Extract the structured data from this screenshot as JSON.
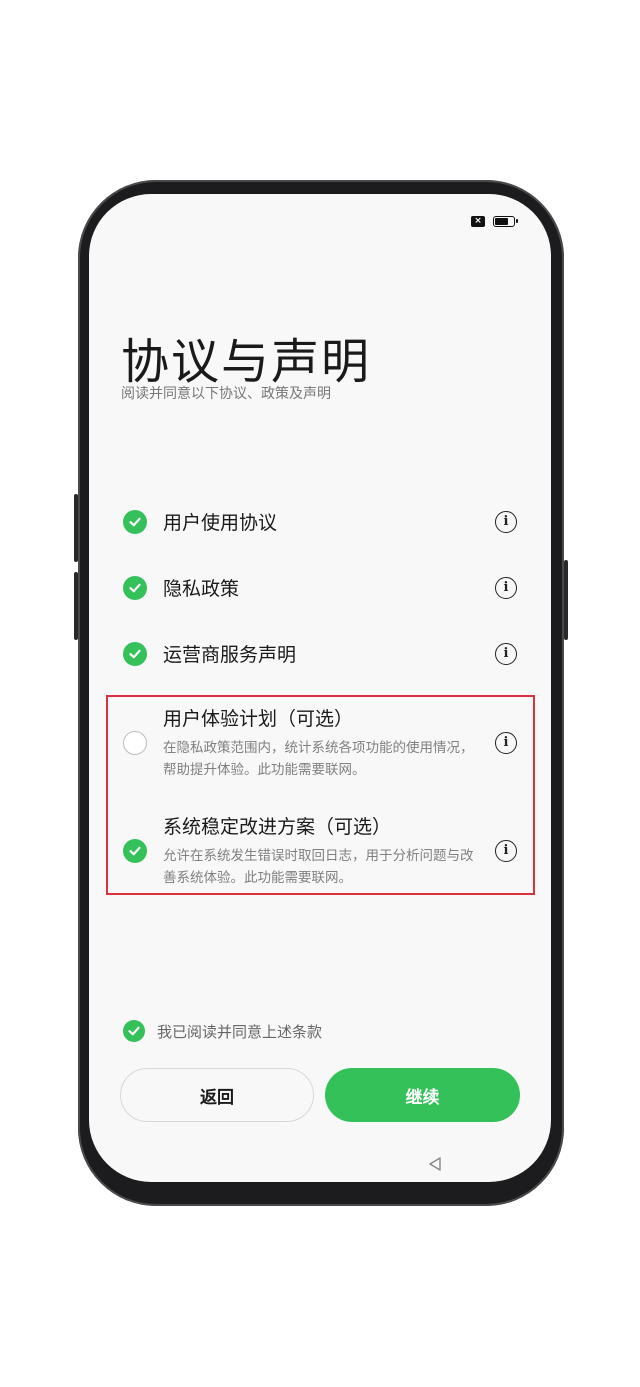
{
  "title": "协议与声明",
  "subtitle": "阅读并同意以下协议、政策及声明",
  "status": {
    "sim_glyph": "×"
  },
  "items": [
    {
      "label": "用户使用协议",
      "checked": true
    },
    {
      "label": "隐私政策",
      "checked": true
    },
    {
      "label": "运营商服务声明",
      "checked": true
    }
  ],
  "optional": [
    {
      "title": "用户体验计划（可选）",
      "desc": "在隐私政策范围内，统计系统各项功能的使用情况，帮助提升体验。此功能需要联网。",
      "checked": false
    },
    {
      "title": "系统稳定改进方案（可选）",
      "desc": "允许在系统发生错误时取回日志，用于分析问题与改善系统体验。此功能需要联网。",
      "checked": true
    }
  ],
  "agree": {
    "label": "我已阅读并同意上述条款",
    "checked": true
  },
  "buttons": {
    "back": "返回",
    "continue": "继续"
  },
  "info_glyph": "i",
  "colors": {
    "accent": "#34c15a",
    "highlight_border": "#d9323f"
  }
}
